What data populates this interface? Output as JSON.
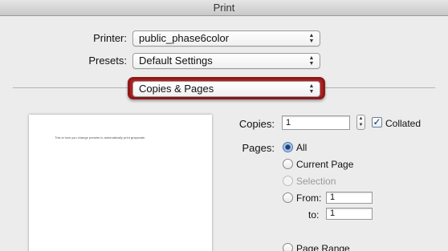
{
  "window": {
    "title": "Print"
  },
  "printer": {
    "label": "Printer:",
    "value": "public_phase6color"
  },
  "presets": {
    "label": "Presets:",
    "value": "Default Settings"
  },
  "section_popup": {
    "value": "Copies & Pages"
  },
  "preview": {
    "text": "This is how you change presets to automatically print grayscale."
  },
  "copies": {
    "label": "Copies:",
    "value": "1",
    "collated_label": "Collated",
    "collated_checked": true
  },
  "pages": {
    "label": "Pages:",
    "options": {
      "all": "All",
      "current": "Current Page",
      "selection": "Selection",
      "from": "From:",
      "to": "to:",
      "page_range": "Page Range"
    },
    "from_value": "1",
    "to_value": "1",
    "selected": "all"
  },
  "icons": {
    "popup_arrows": "up-down-chevron-icon",
    "stepper": "stepper-arrows-icon",
    "checkmark": "checkmark-icon"
  }
}
